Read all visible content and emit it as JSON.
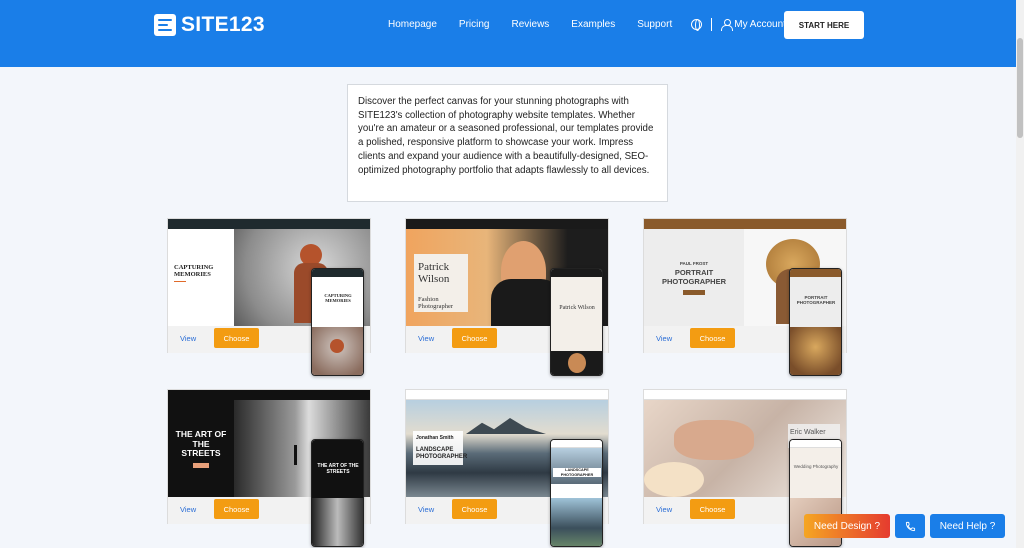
{
  "header": {
    "logo_text": "SITE123",
    "nav": [
      "Homepage",
      "Pricing",
      "Reviews",
      "Examples",
      "Support"
    ],
    "account_label": "My Account",
    "cta_label": "START HERE"
  },
  "intro": {
    "text": "Discover the perfect canvas for your stunning photographs with SITE123's collection of photography website templates. Whether you're an amateur or a seasoned professional, our templates provide a polished, responsive platform to showcase your work. Impress clients and expand your audience with a beautifully-designed, SEO-optimized photography portfolio that adapts flawlessly to all devices."
  },
  "templates": [
    {
      "hero_title": "CAPTURING MEMORIES",
      "mobile_title": "CAPTURING MEMORIES",
      "view_label": "View",
      "choose_label": "Choose"
    },
    {
      "hero_title": "Patrick Wilson",
      "hero_subtitle": "Fashion Photographer",
      "mobile_title": "Patrick Wilson",
      "view_label": "View",
      "choose_label": "Choose"
    },
    {
      "hero_title": "PORTRAIT PHOTOGRAPHER",
      "hero_kicker": "PAUL FROST",
      "mobile_title": "PORTRAIT PHOTOGRAPHER",
      "view_label": "View",
      "choose_label": "Choose"
    },
    {
      "hero_title": "THE ART OF THE STREETS",
      "mobile_title": "THE ART OF THE STREETS",
      "view_label": "View",
      "choose_label": "Choose"
    },
    {
      "hero_title": "LANDSCAPE PHOTOGRAPHER",
      "hero_kicker": "Jonathan Smith",
      "mobile_title": "LANDSCAPE PHOTOGRAPHER",
      "view_label": "View",
      "choose_label": "Choose"
    },
    {
      "hero_title": "Eric Walker",
      "hero_subtitle": "Wedding Photography",
      "mobile_title": "Wedding Photography",
      "view_label": "View",
      "choose_label": "Choose"
    }
  ],
  "floating": {
    "need_design": "Need Design ?",
    "need_help": "Need Help ?"
  },
  "colors": {
    "brand_blue": "#1a7ee8",
    "choose_orange": "#f39c12",
    "page_bg": "#f3f6fb"
  }
}
